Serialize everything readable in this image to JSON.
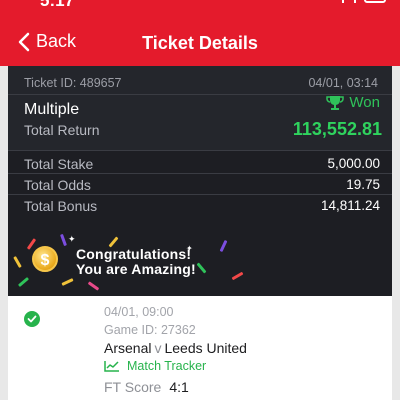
{
  "status_bar": {
    "time": "5:17"
  },
  "header": {
    "back_label": "Back",
    "title": "Ticket Details"
  },
  "ticket": {
    "id_text": "Ticket ID: 489657",
    "date_time": "04/01, 03:14",
    "bet_type": "Multiple",
    "status": "Won",
    "total_return_label": "Total Return",
    "total_return_value": "113,552.81",
    "rows": [
      {
        "label": "Total Stake",
        "value": "5,000.00"
      },
      {
        "label": "Total Odds",
        "value": "19.75"
      },
      {
        "label": "Total Bonus",
        "value": "14,811.24"
      }
    ]
  },
  "banner": {
    "line1": "Congratulations!",
    "line2": "You are Amazing!",
    "coin_symbol": "$"
  },
  "match": {
    "date_time": "04/01, 09:00",
    "game_id_text": "Game ID: 27362",
    "home_team": "Arsenal",
    "separator": "v",
    "away_team": "Leeds United",
    "tracker_label": "Match Tracker",
    "ft_label": "FT Score",
    "ft_score": "4:1"
  },
  "colors": {
    "brand_red": "#e41b2c",
    "win_green": "#2fd35e",
    "panel_dark": "#24262c"
  }
}
